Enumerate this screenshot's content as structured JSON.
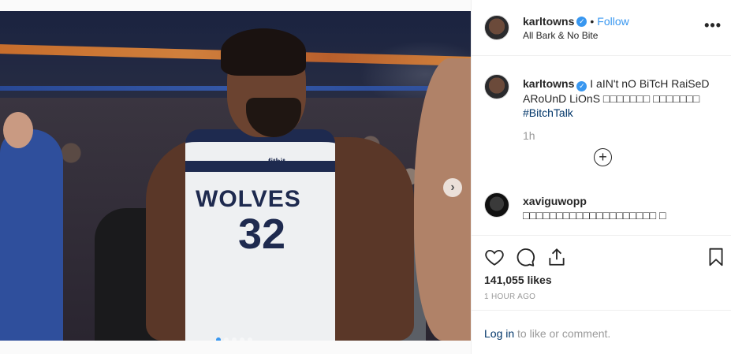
{
  "post": {
    "jersey_text": "WOLVES",
    "jersey_number": "32",
    "jersey_sponsor": "fitbit",
    "next_glyph": "›",
    "carousel": {
      "slides": 5,
      "active": 0
    }
  },
  "header": {
    "username": "karltowns",
    "verified": true,
    "separator": "•",
    "follow_label": "Follow",
    "subtitle": "All Bark & No Bite",
    "more_glyph": "•••"
  },
  "caption": {
    "username": "karltowns",
    "text": "I aIN't nO BiTcH RaiSeD ARoUnD LiOnS □□□□□□□ □□□□□□□",
    "hashtag": "#BitchTalk",
    "time": "1h"
  },
  "comments": [
    {
      "username": "xaviguwopp",
      "text": "□□□□□□□□□□□□□□□□□□□□ □"
    }
  ],
  "actions": {
    "likes": "141,055 likes",
    "ago": "1 HOUR AGO"
  },
  "login": {
    "link": "Log in",
    "rest": " to like or comment."
  },
  "colors": {
    "accent": "#3897f0",
    "link": "#003569",
    "muted": "#999999"
  },
  "icons": [
    "heart-icon",
    "comment-icon",
    "share-icon",
    "bookmark-icon",
    "add-comment-icon",
    "verified-icon",
    "more-icon",
    "chevron-right-icon"
  ]
}
